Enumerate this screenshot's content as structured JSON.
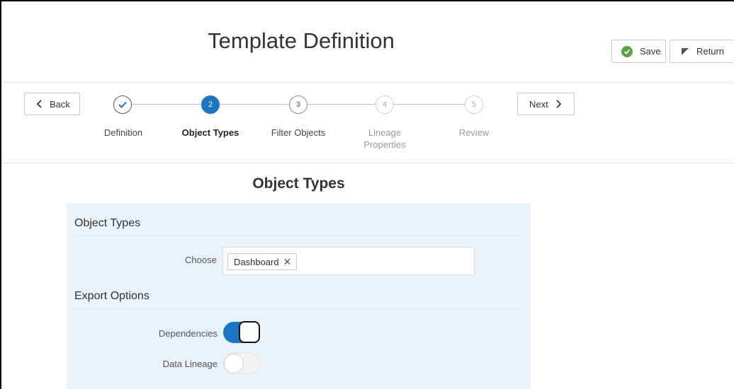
{
  "header": {
    "title": "Template Definition",
    "save_label": "Save",
    "return_label": "Return"
  },
  "train": {
    "back_label": "Back",
    "next_label": "Next",
    "steps": [
      {
        "number": "✓",
        "label": "Definition",
        "state": "completed"
      },
      {
        "number": "2",
        "label": "Object Types",
        "state": "current"
      },
      {
        "number": "3",
        "label": "Filter Objects",
        "state": "upcoming"
      },
      {
        "number": "4",
        "label": "Lineage Properties",
        "state": "disabled"
      },
      {
        "number": "5",
        "label": "Review",
        "state": "disabled"
      }
    ]
  },
  "main": {
    "section_title": "Object Types",
    "object_types": {
      "group_title": "Object Types",
      "choose_label": "Choose",
      "selected": [
        "Dashboard"
      ]
    },
    "export_options": {
      "group_title": "Export Options",
      "dependencies_label": "Dependencies",
      "dependencies_on": true,
      "data_lineage_label": "Data Lineage",
      "data_lineage_on": false
    }
  },
  "colors": {
    "accent": "#1b75c3",
    "save_icon": "#5aa245",
    "panel_bg": "#e9f3fb"
  }
}
